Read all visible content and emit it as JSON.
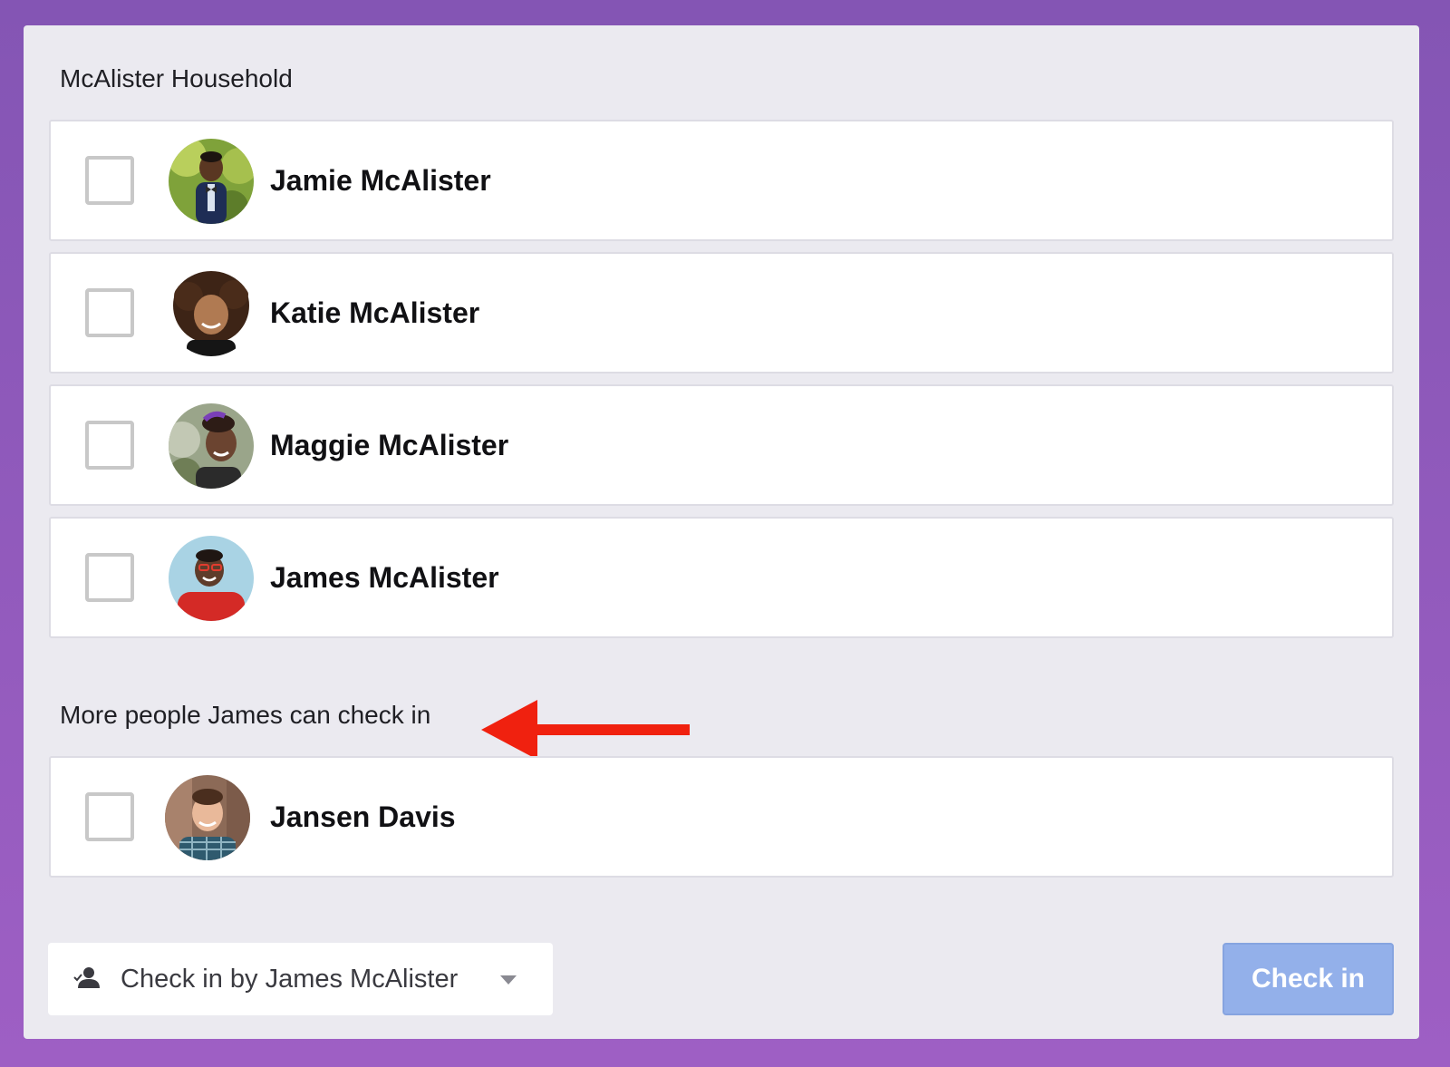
{
  "household": {
    "title": "McAlister Household",
    "members": [
      {
        "name": "Jamie McAlister",
        "checked": false
      },
      {
        "name": "Katie McAlister",
        "checked": false
      },
      {
        "name": "Maggie McAlister",
        "checked": false
      },
      {
        "name": "James McAlister",
        "checked": false
      }
    ]
  },
  "more_people": {
    "title": "More people James can check in",
    "members": [
      {
        "name": "Jansen Davis",
        "checked": false
      }
    ]
  },
  "footer": {
    "checkin_by": {
      "label": "Check in by James McAlister",
      "icon": "person-icon"
    },
    "checkin_button_label": "Check in"
  },
  "colors": {
    "background": "#8455b4",
    "panel": "#ebeaf0",
    "primary_disabled": "#93b0ea",
    "arrow": "#f0210f"
  }
}
